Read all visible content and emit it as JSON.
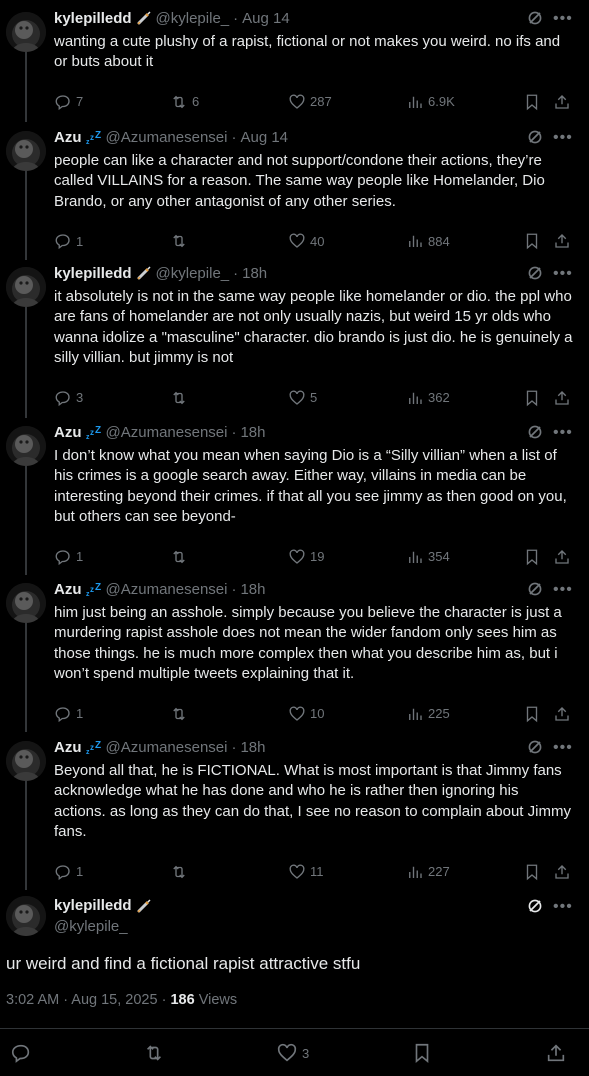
{
  "colors": {
    "background": "#000000",
    "text": "#e7e9ea",
    "muted": "#71767b",
    "verified": "#1d9bf0"
  },
  "replies": [
    {
      "name": "kylepilledd",
      "emoji": "syringe-icon",
      "handle": "@kylepile_",
      "time": "Aug 14",
      "text": "wanting a cute plushy of a rapist, fictional or not makes you weird. no ifs and or buts about it",
      "replies": "7",
      "reposts": "6",
      "likes": "287",
      "views": "6.9K"
    },
    {
      "name": "Azu",
      "emoji": "sleep-zz-icon",
      "handle": "@Azumanesensei",
      "time": "Aug 14",
      "text": "people can like a character and not support/condone their actions, they’re called VILLAINS for a reason. The same way people like Homelander, Dio Brando, or any other antagonist of any other series.",
      "replies": "1",
      "reposts": "",
      "likes": "40",
      "views": "884"
    },
    {
      "name": "kylepilledd",
      "emoji": "syringe-icon",
      "handle": "@kylepile_",
      "time": "18h",
      "text": "it absolutely is not in the same way people like homelander or dio. the ppl who are fans of homelander are not only usually nazis, but weird 15 yr olds who wanna idolize a \"masculine\" character. dio brando is just dio. he is genuinely a silly villian. but jimmy is not",
      "replies": "3",
      "reposts": "",
      "likes": "5",
      "views": "362"
    },
    {
      "name": "Azu",
      "emoji": "sleep-zz-icon",
      "handle": "@Azumanesensei",
      "time": "18h",
      "text": "I don’t know what you mean when saying Dio is a “Silly villian” when a list of his crimes is a google search away. Either way, villains in media can be interesting beyond their crimes. if that all you see jimmy as then good on you, but others can see beyond-",
      "replies": "1",
      "reposts": "",
      "likes": "19",
      "views": "354"
    },
    {
      "name": "Azu",
      "emoji": "sleep-zz-icon",
      "handle": "@Azumanesensei",
      "time": "18h",
      "text": "him just being an asshole. simply because you believe the character is just a murdering rapist asshole does not mean the wider fandom only sees him as those things. he is much more complex then what you describe him as, but i won’t spend multiple tweets explaining that it.",
      "replies": "1",
      "reposts": "",
      "likes": "10",
      "views": "225"
    },
    {
      "name": "Azu",
      "emoji": "sleep-zz-icon",
      "handle": "@Azumanesensei",
      "time": "18h",
      "text": "Beyond all that, he is FICTIONAL. What is most important is that Jimmy fans acknowledge what he has done and who he is rather then ignoring his actions. as long as they can do that, I see no reason to complain about Jimmy fans.",
      "replies": "1",
      "reposts": "",
      "likes": "11",
      "views": "227"
    }
  ],
  "main": {
    "name": "kylepilledd",
    "emoji": "syringe-icon",
    "handle": "@kylepile_",
    "text": "ur weird and find a fictional rapist attractive stfu",
    "timestamp": "3:02 AM · Aug 15, 2025 ·",
    "views_count": "186",
    "views_label": "Views",
    "likes": "3"
  },
  "separator": "·"
}
